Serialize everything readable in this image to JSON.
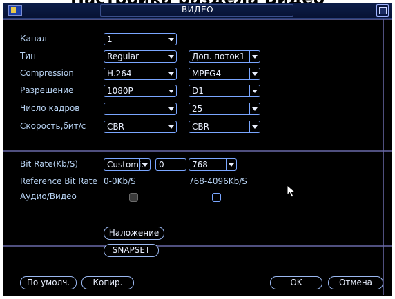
{
  "overlay_text": "Настройка раздела Видео",
  "window": {
    "title": "ВИДЕО"
  },
  "labels": {
    "channel": "Канал",
    "type": "Тип",
    "compression": "Compression",
    "resolution": "Разрешение",
    "frame_rate": "Число кадров",
    "bitrate_type": "Скорость,бит/с",
    "bit_rate": "Bit Rate(Kb/S)",
    "reference_bit_rate": "Reference Bit Rate",
    "audio_video": "Аудио/Видео"
  },
  "main_stream": {
    "channel": "1",
    "type": "Regular",
    "compression": "H.264",
    "resolution": "1080P",
    "frame_rate": "",
    "bitrate_type": "CBR",
    "bit_rate_mode": "Customi:",
    "bit_rate_value": "0",
    "reference_bit_rate": "0-0Kb/S",
    "audio_video_checked": false
  },
  "extra_stream": {
    "type": "Доп. поток1",
    "compression": "MPEG4",
    "resolution": "D1",
    "frame_rate": "25",
    "bitrate_type": "CBR",
    "bit_rate": "768",
    "reference_bit_rate": "768-4096Kb/S",
    "audio_video_checked": false
  },
  "buttons": {
    "overlay": "Наложение",
    "snapset": "SNAPSET",
    "default": "По умолч.",
    "copy": "Копир.",
    "ok": "OK",
    "cancel": "Отмена"
  },
  "colors": {
    "background": "#000000",
    "label": "#b7d2f2",
    "border": "#7aa6ff",
    "titlebar": "#0d1e4a"
  }
}
